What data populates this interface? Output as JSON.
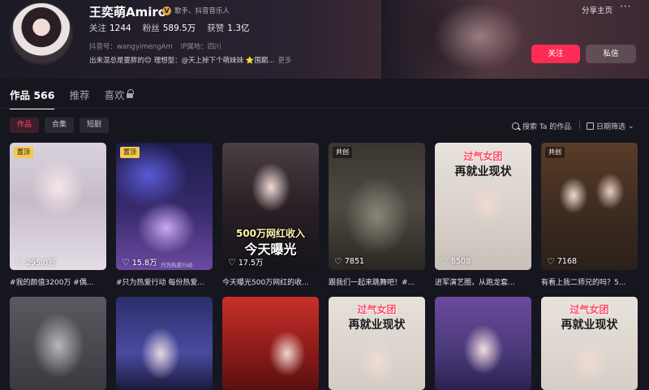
{
  "profile": {
    "name": "王奕萌Amiro",
    "verify": "歌手、抖音音乐人",
    "stats": [
      {
        "label": "关注",
        "value": "1244"
      },
      {
        "label": "粉丝",
        "value": "589.5万"
      },
      {
        "label": "获赞",
        "value": "1.3亿"
      }
    ],
    "account_id": "抖音号：wangyimengAm",
    "ip": "IP属地：四川",
    "bio": "出来混总是要胖的😊 理想型：@天上掉下个萌妹妹 ⭐围巅...",
    "bio_more": "更多",
    "share": "分享主页",
    "more": "···",
    "follow": "关注",
    "message": "私信"
  },
  "tabs": [
    {
      "label": "作品 566"
    },
    {
      "label": "推荐"
    },
    {
      "label": "喜欢"
    }
  ],
  "chips": [
    "作品",
    "合集",
    "短剧"
  ],
  "search_label": "搜索 Ta 的作品",
  "filter_label": "日期筛选",
  "cards": [
    {
      "badge": "置顶",
      "likes": "295.0万",
      "caption": "#我的颜值3200万 #偶..."
    },
    {
      "badge": "置顶",
      "likes": "15.8万",
      "caption": "#只为热爱行动 每份热爱...",
      "watermark": "只为热爱行动"
    },
    {
      "badge": "",
      "likes": "17.5万",
      "caption": "今天曝光500万网红的收...",
      "overlay": "500万网红收入",
      "overlay2": "今天曝光"
    },
    {
      "badge": "共创",
      "likes": "7851",
      "caption": "跟我们一起来跳舞吧！#..."
    },
    {
      "badge": "",
      "likes": "8508",
      "caption": "进军演艺圈，从跑龙套...",
      "overlay": "过气女团",
      "overlay2": "再就业现状"
    },
    {
      "badge": "共创",
      "likes": "7168",
      "caption": "有看上我二师兄的吗？5..."
    },
    {
      "badge": "",
      "likes": "",
      "caption": ""
    },
    {
      "badge": "",
      "likes": "",
      "caption": ""
    },
    {
      "badge": "",
      "likes": "",
      "caption": ""
    },
    {
      "badge": "",
      "likes": "",
      "caption": "",
      "overlay": "过气女团",
      "overlay2": "再就业现状"
    },
    {
      "badge": "",
      "likes": "",
      "caption": ""
    },
    {
      "badge": "",
      "likes": "",
      "caption": "",
      "overlay": "过气女团",
      "overlay2": "再就业现状"
    }
  ]
}
